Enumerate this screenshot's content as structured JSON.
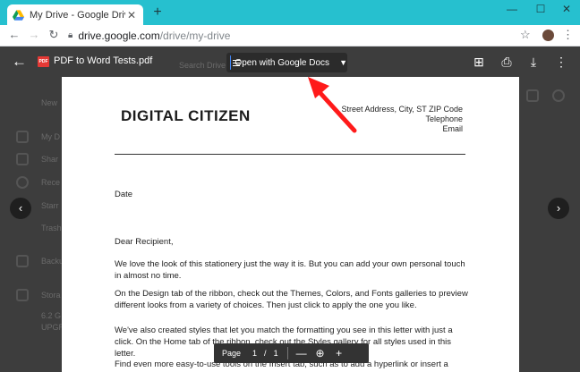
{
  "browser": {
    "tab_title": "My Drive - Google Drive",
    "tab_close": "✕",
    "new_tab": "+",
    "minimize": "—",
    "maximize": "☐",
    "close": "✕",
    "url_host": "drive.google.com",
    "url_path": "/drive/my-drive",
    "back": "←",
    "forward": "→",
    "reload": "↻",
    "star": "☆",
    "menu": "⋮"
  },
  "viewer": {
    "back": "←",
    "file_badge": "PDF",
    "file_name": "PDF to Word Tests.pdf",
    "open_with_label": "Open with Google Docs",
    "open_with_caret": "▼",
    "add_comment": "⊞",
    "print": "⎙",
    "download": "⤓",
    "more": "⋮"
  },
  "document": {
    "logo": "DIGITAL CITIZEN",
    "address": [
      "Street Address, City, ST ZIP Code",
      "Telephone",
      "Email"
    ],
    "date": "Date",
    "salutation": "Dear Recipient,",
    "para1": "We love the look of this stationery just the way it is. But you can add your own personal touch in almost no time.",
    "para2": "On the Design tab of the ribbon, check out the Themes, Colors, and Fonts galleries to preview different looks from a variety of choices. Then just click to apply the one you like.",
    "para3": "We've also created styles that let you match the formatting you see in this letter with just a click. On the Home tab of the ribbon, check out the Styles gallery for all styles used in this letter.",
    "para4": "Find even more easy-to-use tools on the Insert tab, such as to add a hyperlink or insert a comment."
  },
  "page_toolbar": {
    "label": "Page",
    "current": "1",
    "separator": "/",
    "total": "1",
    "zoom_out": "—",
    "zoom_icon": "⊕",
    "zoom_in": "+"
  },
  "nav": {
    "prev": "‹",
    "next": "›"
  },
  "background": {
    "new_label": "New",
    "my_drive": "My D",
    "shared": "Shar",
    "recent": "Rece",
    "starred": "Starr",
    "trash": "Trash",
    "backups": "Backu",
    "storage": "Stora",
    "storage_used": "6.2 G",
    "upgrade": "UPGR",
    "search": "Search Drive"
  },
  "colors": {
    "titlebar": "#26c0cf",
    "pdf_badge": "#e53935",
    "docs_blue": "#4285f4",
    "annotation_arrow": "#ff1a1a"
  }
}
